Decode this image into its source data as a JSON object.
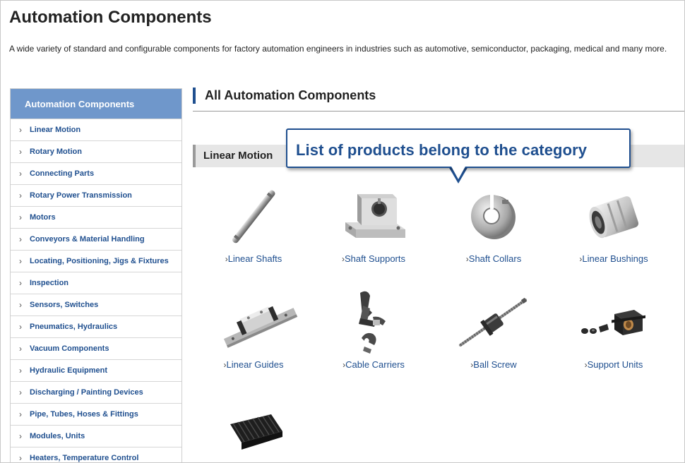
{
  "page": {
    "title": "Automation Components",
    "description": "A wide variety of standard and configurable components for factory automation engineers in industries such as automotive, semiconductor, packaging, medical and many more."
  },
  "sidebar": {
    "header": "Automation Components",
    "items": [
      {
        "label": "Linear Motion"
      },
      {
        "label": "Rotary Motion"
      },
      {
        "label": "Connecting Parts"
      },
      {
        "label": "Rotary Power Transmission"
      },
      {
        "label": "Motors"
      },
      {
        "label": "Conveyors & Material Handling"
      },
      {
        "label": "Locating, Positioning, Jigs & Fixtures"
      },
      {
        "label": "Inspection"
      },
      {
        "label": "Sensors, Switches"
      },
      {
        "label": "Pneumatics, Hydraulics"
      },
      {
        "label": "Vacuum Components"
      },
      {
        "label": "Hydraulic Equipment"
      },
      {
        "label": "Discharging / Painting Devices"
      },
      {
        "label": "Pipe, Tubes, Hoses & Fittings"
      },
      {
        "label": "Modules, Units"
      },
      {
        "label": "Heaters, Temperature Control"
      }
    ]
  },
  "main": {
    "title": "All Automation Components",
    "section_title": "Linear Motion",
    "callout": "List of products belong to the category",
    "products": [
      {
        "label": "Linear Shafts",
        "icon": "linear-shaft-icon"
      },
      {
        "label": "Shaft Supports",
        "icon": "shaft-support-icon"
      },
      {
        "label": "Shaft Collars",
        "icon": "shaft-collar-icon"
      },
      {
        "label": "Linear Bushings",
        "icon": "linear-bushing-icon"
      },
      {
        "label": "Linear Guides",
        "icon": "linear-guide-icon"
      },
      {
        "label": "Cable Carriers",
        "icon": "cable-carrier-icon"
      },
      {
        "label": "Ball Screw",
        "icon": "ball-screw-icon"
      },
      {
        "label": "Support Units",
        "icon": "support-unit-icon"
      },
      {
        "label": "",
        "icon": "bellows-cover-icon"
      }
    ]
  },
  "colors": {
    "accent": "#1f4f8f",
    "sidebar_header": "#6f97cb",
    "section_band": "#e6e6e6"
  }
}
